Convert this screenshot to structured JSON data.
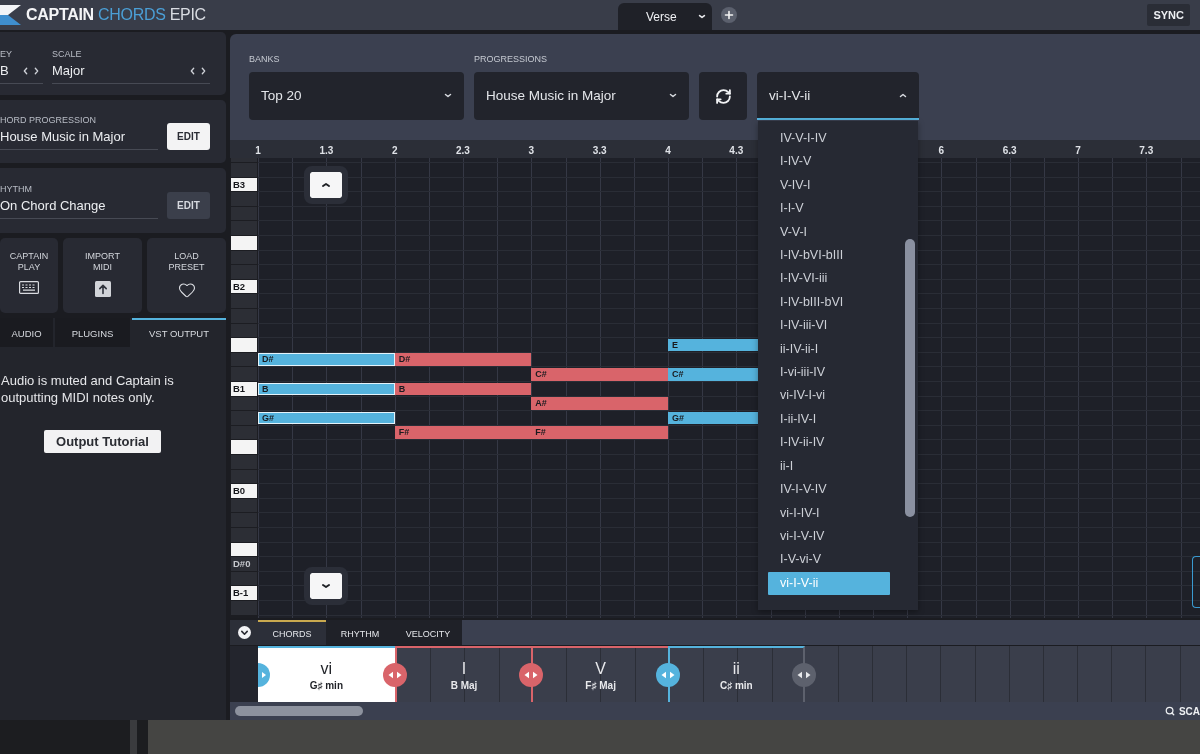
{
  "top_bar": {
    "logo": [
      {
        "text": "CAPTAIN",
        "kind": "strong"
      },
      {
        "text": "CHORDS",
        "kind": "accent"
      },
      {
        "text": "EPIC",
        "kind": "plain"
      }
    ],
    "section_tab": "Verse",
    "sync_button": "SYNC"
  },
  "sidebar": {
    "key": {
      "label": "EY",
      "value": "B"
    },
    "scale": {
      "label": "SCALE",
      "value": "Major"
    },
    "settings": [
      {
        "label": "HORD PROGRESSION",
        "value": "House Music in Major",
        "button": {
          "label": "EDIT",
          "kind": "primary"
        }
      },
      {
        "label": "HYTHM",
        "value": "On Chord Change",
        "button": {
          "label": "EDIT",
          "kind": "secondary"
        }
      }
    ],
    "tiles": [
      {
        "label": "CAPTAIN PLAY",
        "kind": "keyboard"
      },
      {
        "label": "IMPORT MIDI",
        "kind": "upload"
      },
      {
        "label": "LOAD PRESET",
        "kind": "heart"
      }
    ],
    "tabs": [
      {
        "label": "AUDIO",
        "selected": false
      },
      {
        "label": "PLUGINS",
        "selected": false
      },
      {
        "label": "VST OUTPUT",
        "selected": true
      }
    ],
    "message": "Audio is muted and Captain is outputting MIDI notes only.",
    "tutorial_button": "Output Tutorial"
  },
  "header": {
    "fields": [
      {
        "label": "BANKS",
        "value": "Top 20"
      },
      {
        "label": "PROGRESSIONS",
        "value": "House Music in Major"
      }
    ],
    "variation": {
      "value": "vi-I-V-ii",
      "expanded": true
    },
    "variation_menu": [
      {
        "label": "IV-V-I-IV",
        "selected": false
      },
      {
        "label": "I-IV-V",
        "selected": false
      },
      {
        "label": "V-IV-I",
        "selected": false
      },
      {
        "label": "I-I-V",
        "selected": false
      },
      {
        "label": "V-V-I",
        "selected": false
      },
      {
        "label": "I-IV-bVI-bIII",
        "selected": false
      },
      {
        "label": "I-IV-VI-iii",
        "selected": false
      },
      {
        "label": "I-IV-bIII-bVI",
        "selected": false
      },
      {
        "label": "I-IV-iii-VI",
        "selected": false
      },
      {
        "label": "ii-IV-ii-I",
        "selected": false
      },
      {
        "label": "I-vi-iii-IV",
        "selected": false
      },
      {
        "label": "vi-IV-I-vi",
        "selected": false
      },
      {
        "label": "I-ii-IV-I",
        "selected": false
      },
      {
        "label": "I-IV-ii-IV",
        "selected": false
      },
      {
        "label": "ii-I",
        "selected": false
      },
      {
        "label": "IV-I-V-IV",
        "selected": false
      },
      {
        "label": "vi-I-IV-I",
        "selected": false
      },
      {
        "label": "vi-I-V-IV",
        "selected": false
      },
      {
        "label": "I-V-vi-V",
        "selected": false
      },
      {
        "label": "vi-I-V-ii",
        "selected": true
      }
    ]
  },
  "ruler": {
    "ticks_before_menu": [
      "1",
      "1.3",
      "2",
      "2.3",
      "3",
      "3.3",
      "4",
      "4.3"
    ],
    "ticks_after_menu": [
      "6",
      "6.3",
      "7",
      "7.3"
    ]
  },
  "piano_roll": {
    "rows": [
      {
        "kind": "dark"
      },
      {
        "kind": "dark"
      },
      {
        "kind": "light",
        "label": "B3"
      },
      {
        "kind": "dark"
      },
      {
        "kind": "dark"
      },
      {
        "kind": "dark"
      },
      {
        "kind": "light"
      },
      {
        "kind": "dark"
      },
      {
        "kind": "dark"
      },
      {
        "kind": "light",
        "label": "B2"
      },
      {
        "kind": "dark"
      },
      {
        "kind": "dark"
      },
      {
        "kind": "dark"
      },
      {
        "kind": "light",
        "slots": [
          {
            "kind": "rest"
          },
          {
            "kind": "rest"
          },
          {
            "kind": "rest"
          },
          {
            "kind": "note",
            "label": "E"
          }
        ]
      },
      {
        "kind": "dark",
        "slots": [
          {
            "kind": "note",
            "label": "D#"
          },
          {
            "kind": "note",
            "label": "D#"
          },
          {
            "kind": "rest"
          },
          {
            "kind": "rest"
          }
        ]
      },
      {
        "kind": "dark",
        "slots": [
          {
            "kind": "rest"
          },
          {
            "kind": "rest"
          },
          {
            "kind": "note",
            "label": "C#"
          },
          {
            "kind": "note",
            "label": "C#"
          }
        ]
      },
      {
        "kind": "light",
        "label": "B1",
        "slots": [
          {
            "kind": "note",
            "label": "B"
          },
          {
            "kind": "note",
            "label": "B"
          },
          {
            "kind": "rest"
          },
          {
            "kind": "rest"
          }
        ]
      },
      {
        "kind": "dark",
        "slots": [
          {
            "kind": "rest"
          },
          {
            "kind": "rest"
          },
          {
            "kind": "note",
            "label": "A#"
          },
          {
            "kind": "rest"
          }
        ]
      },
      {
        "kind": "dark",
        "slots": [
          {
            "kind": "note",
            "label": "G#"
          },
          {
            "kind": "rest"
          },
          {
            "kind": "rest"
          },
          {
            "kind": "note",
            "label": "G#"
          }
        ]
      },
      {
        "kind": "dark",
        "slots": [
          {
            "kind": "rest"
          },
          {
            "kind": "note",
            "label": "F#"
          },
          {
            "kind": "note",
            "label": "F#"
          },
          {
            "kind": "rest"
          }
        ]
      },
      {
        "kind": "light"
      },
      {
        "kind": "dark"
      },
      {
        "kind": "dark"
      },
      {
        "kind": "light",
        "label": "B0"
      },
      {
        "kind": "dark"
      },
      {
        "kind": "dark"
      },
      {
        "kind": "dark"
      },
      {
        "kind": "light"
      },
      {
        "kind": "dark",
        "label": "D#0"
      },
      {
        "kind": "dark"
      },
      {
        "kind": "light",
        "label": "B-1"
      },
      {
        "kind": "dark"
      }
    ]
  },
  "chord_track": {
    "tabs": [
      {
        "label": "CHORDS",
        "selected": true
      },
      {
        "label": "RHYTHM",
        "selected": false
      },
      {
        "label": "VELOCITY",
        "selected": false
      }
    ],
    "chords": [
      {
        "numeral": "vi",
        "name": "G♯ min",
        "color": "#55b3dd",
        "selected": true
      },
      {
        "numeral": "I",
        "name": "B Maj",
        "color": "#d9646a",
        "selected": false
      },
      {
        "numeral": "V",
        "name": "F♯ Maj",
        "color": "#d9646a",
        "selected": false
      },
      {
        "numeral": "ii",
        "name": "C♯ min",
        "color": "#55b3dd",
        "selected": false
      }
    ],
    "zoom_label": "SCA"
  }
}
